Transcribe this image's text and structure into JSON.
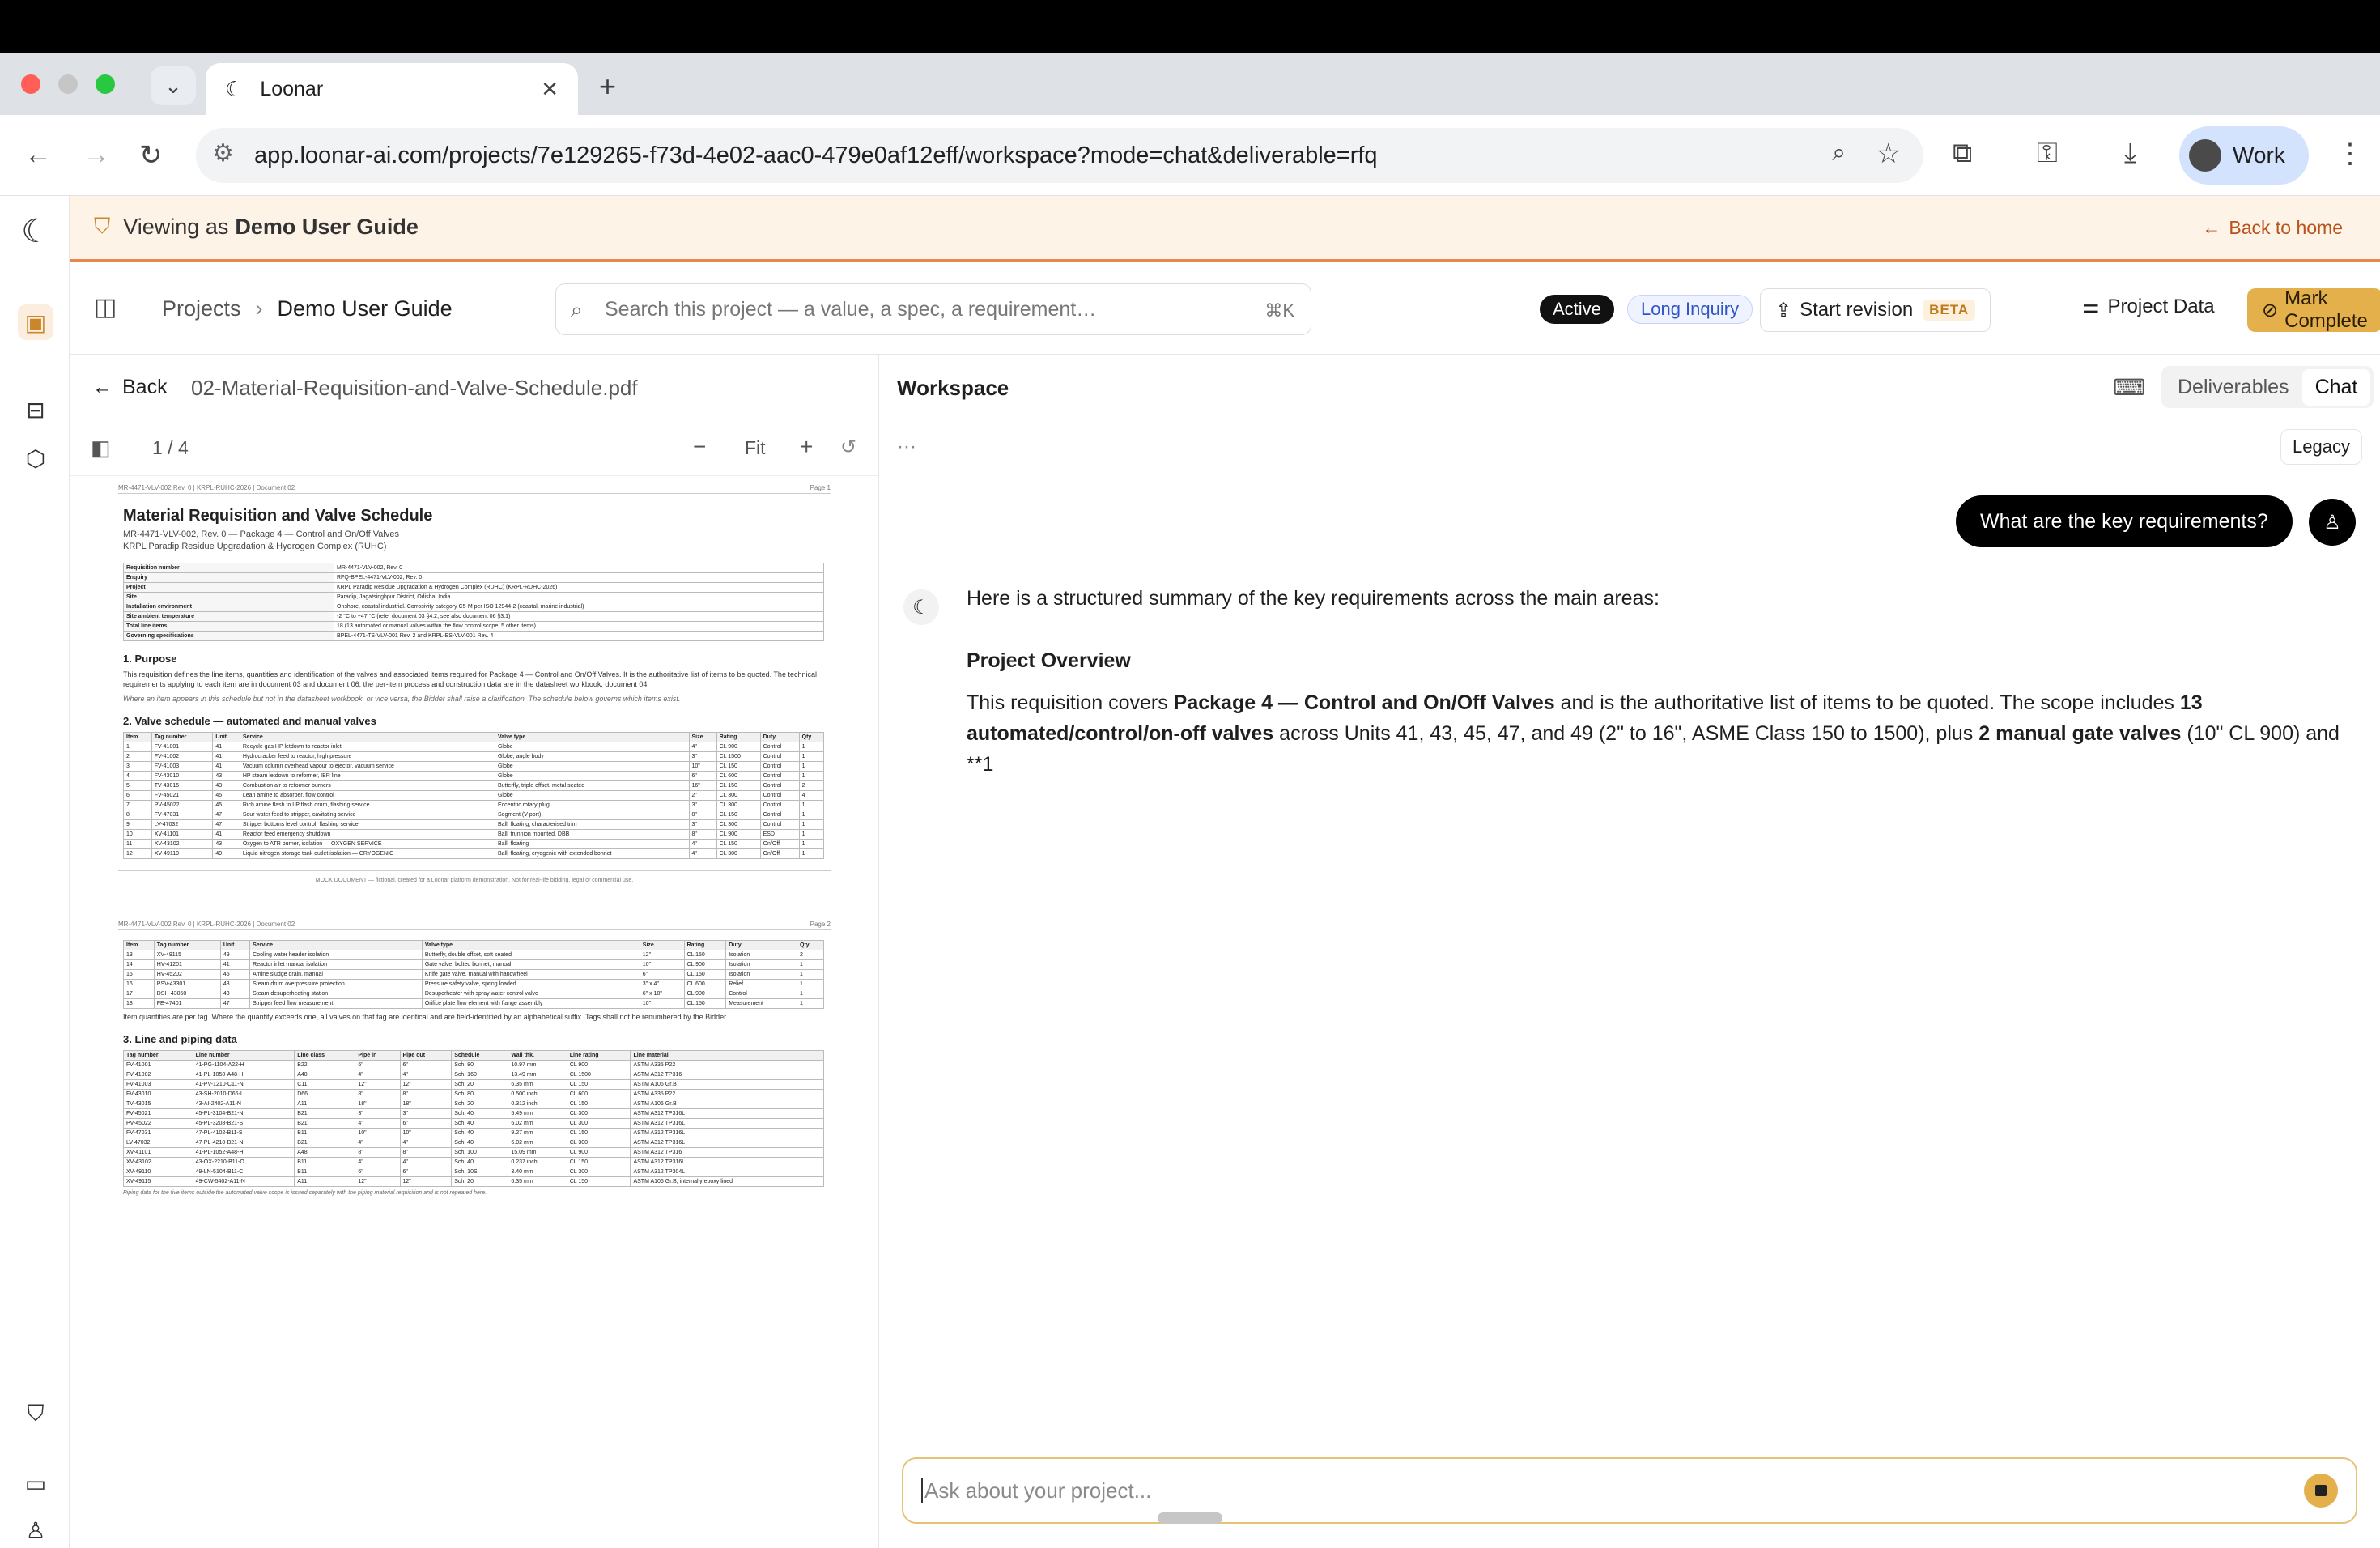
{
  "browser": {
    "tab_title": "Loonar",
    "url": "app.loonar-ai.com/projects/7e129265-f73d-4e02-aac0-479e0af12eff/workspace?mode=chat&deliverable=rfq",
    "profile_label": "Work"
  },
  "banner": {
    "prefix": "Viewing as",
    "user": "Demo User Guide",
    "back_label": "Back to home"
  },
  "header": {
    "breadcrumb_root": "Projects",
    "breadcrumb_current": "Demo User Guide",
    "search_placeholder": "Search this project — a value, a spec, a requirement…",
    "search_shortcut": "⌘K",
    "status_active": "Active",
    "status_inquiry": "Long Inquiry",
    "revision_label": "Start revision",
    "revision_badge": "BETA",
    "project_data_label": "Project Data",
    "complete_label": "Mark Complete"
  },
  "pdf": {
    "back_label": "Back",
    "filename": "02-Material-Requisition-and-Valve-Schedule.pdf",
    "page_indicator": "1 / 4",
    "fit_label": "Fit",
    "page1": {
      "header_left": "MR-4471-VLV-002 Rev. 0 | KRPL-RUHC-2026 | Document 02",
      "header_right": "Page 1",
      "title": "Material Requisition and Valve Schedule",
      "subtitle1": "MR-4471-VLV-002, Rev. 0 — Package 4 — Control and On/Off Valves",
      "subtitle2": "KRPL Paradip Residue Upgradation & Hydrogen Complex (RUHC)",
      "kv": [
        [
          "Requisition number",
          "MR-4471-VLV-002, Rev. 0"
        ],
        [
          "Enquiry",
          "RFQ-BPEL-4471-VLV-002, Rev. 0"
        ],
        [
          "Project",
          "KRPL Paradip Residue Upgradation & Hydrogen Complex (RUHC) (KRPL-RUHC-2026)"
        ],
        [
          "Site",
          "Paradip, Jagatsinghpur District, Odisha, India"
        ],
        [
          "Installation environment",
          "Onshore, coastal industrial. Corrosivity category C5-M per ISO 12944-2 (coastal, marine industrial)"
        ],
        [
          "Site ambient temperature",
          "-2 °C to +47 °C (refer document 03 §4.2; see also document 06 §3.1)"
        ],
        [
          "Total line items",
          "18 (13 automated or manual valves within the flow control scope, 5 other items)"
        ],
        [
          "Governing specifications",
          "BPEL-4471-TS-VLV-001 Rev. 2 and KRPL-ES-VLV-001 Rev. 4"
        ]
      ],
      "purpose_heading": "1. Purpose",
      "purpose_text": "This requisition defines the line items, quantities and identification of the valves and associated items required for Package 4 — Control and On/Off Valves. It is the authoritative list of items to be quoted. The technical requirements applying to each item are in document 03 and document 06; the per-item process and construction data are in the datasheet workbook, document 04.",
      "purpose_note": "Where an item appears in this schedule but not in the datasheet workbook, or vice versa, the Bidder shall raise a clarification. The schedule below governs which items exist.",
      "schedule_heading": "2. Valve schedule — automated and manual valves",
      "schedule_cols": [
        "Item",
        "Tag number",
        "Unit",
        "Service",
        "Valve type",
        "Size",
        "Rating",
        "Duty",
        "Qty"
      ],
      "schedule_rows": [
        [
          "1",
          "FV-41001",
          "41",
          "Recycle gas HP letdown to reactor inlet",
          "Globe",
          "4\"",
          "CL 900",
          "Control",
          "1"
        ],
        [
          "2",
          "FV-41002",
          "41",
          "Hydrocracker feed to reactor, high pressure",
          "Globe, angle body",
          "3\"",
          "CL 1500",
          "Control",
          "1"
        ],
        [
          "3",
          "FV-41003",
          "41",
          "Vacuum column overhead vapour to ejector, vacuum service",
          "Globe",
          "10\"",
          "CL 150",
          "Control",
          "1"
        ],
        [
          "4",
          "FV-43010",
          "43",
          "HP steam letdown to reformer, IBR line",
          "Globe",
          "6\"",
          "CL 600",
          "Control",
          "1"
        ],
        [
          "5",
          "TV-43015",
          "43",
          "Combustion air to reformer burners",
          "Butterfly, triple offset, metal seated",
          "16\"",
          "CL 150",
          "Control",
          "2"
        ],
        [
          "6",
          "FV-45021",
          "45",
          "Lean amine to absorber, flow control",
          "Globe",
          "2\"",
          "CL 300",
          "Control",
          "4"
        ],
        [
          "7",
          "PV-45022",
          "45",
          "Rich amine flash to LP flash drum, flashing service",
          "Eccentric rotary plug",
          "3\"",
          "CL 300",
          "Control",
          "1"
        ],
        [
          "8",
          "FV-47031",
          "47",
          "Sour water feed to stripper, cavitating service",
          "Segment (V-port)",
          "8\"",
          "CL 150",
          "Control",
          "1"
        ],
        [
          "9",
          "LV-47032",
          "47",
          "Stripper bottoms level control, flashing service",
          "Ball, floating, characterised trim",
          "3\"",
          "CL 300",
          "Control",
          "1"
        ],
        [
          "10",
          "XV-41101",
          "41",
          "Reactor feed emergency shutdown",
          "Ball, trunnion mounted, DBB",
          "8\"",
          "CL 900",
          "ESD",
          "1"
        ],
        [
          "11",
          "XV-43102",
          "43",
          "Oxygen to ATR burner, isolation — OXYGEN SERVICE",
          "Ball, floating",
          "4\"",
          "CL 150",
          "On/Off",
          "1"
        ],
        [
          "12",
          "XV-49110",
          "49",
          "Liquid nitrogen storage tank outlet isolation — CRYOGENIC",
          "Ball, floating, cryogenic with extended bonnet",
          "4\"",
          "CL 300",
          "On/Off",
          "1"
        ]
      ],
      "footer": "MOCK DOCUMENT — fictional, created for a Loonar platform demonstration. Not for real-life bidding, legal or commercial use."
    },
    "page2": {
      "header_left": "MR-4471-VLV-002 Rev. 0 | KRPL-RUHC-2026 | Document 02",
      "header_right": "Page 2",
      "schedule_rows": [
        [
          "13",
          "XV-49115",
          "49",
          "Cooling water header isolation",
          "Butterfly, double offset, soft seated",
          "12\"",
          "CL 150",
          "Isolation",
          "2"
        ],
        [
          "14",
          "HV-41201",
          "41",
          "Reactor inlet manual isolation",
          "Gate valve, bolted bonnet, manual",
          "10\"",
          "CL 900",
          "Isolation",
          "1"
        ],
        [
          "15",
          "HV-45202",
          "45",
          "Amine sludge drain, manual",
          "Knife gate valve, manual with handwheel",
          "6\"",
          "CL 150",
          "Isolation",
          "1"
        ],
        [
          "16",
          "PSV-43301",
          "43",
          "Steam drum overpressure protection",
          "Pressure safety valve, spring loaded",
          "3\" x 4\"",
          "CL 600",
          "Relief",
          "1"
        ],
        [
          "17",
          "DSH-43050",
          "43",
          "Steam desuperheating station",
          "Desuperheater with spray water control valve",
          "6\" x 10\"",
          "CL 900",
          "Control",
          "1"
        ],
        [
          "18",
          "FE-47401",
          "47",
          "Stripper feed flow measurement",
          "Orifice plate flow element with flange assembly",
          "10\"",
          "CL 150",
          "Measurement",
          "1"
        ]
      ],
      "qty_note": "Item quantities are per tag. Where the quantity exceeds one, all valves on that tag are identical and are field-identified by an alphabetical suffix. Tags shall not be renumbered by the Bidder.",
      "line_heading": "3. Line and piping data",
      "line_cols": [
        "Tag number",
        "Line number",
        "Line class",
        "Pipe in",
        "Pipe out",
        "Schedule",
        "Wall thk.",
        "Line rating",
        "Line material"
      ],
      "line_rows": [
        [
          "FV-41001",
          "41-PG-1104-A22-H",
          "B22",
          "6\"",
          "6\"",
          "Sch. 80",
          "10.97 mm",
          "CL 900",
          "ASTM A335 P22"
        ],
        [
          "FV-41002",
          "41-PL-1050-A48-H",
          "A48",
          "4\"",
          "4\"",
          "Sch. 160",
          "13.49 mm",
          "CL 1500",
          "ASTM A312 TP316"
        ],
        [
          "FV-41003",
          "41-PV-1210-C11-N",
          "C11",
          "12\"",
          "12\"",
          "Sch. 20",
          "6.35 mm",
          "CL 150",
          "ASTM A106 Gr.B"
        ],
        [
          "FV-43010",
          "43-SH-2010-D66-I",
          "D66",
          "8\"",
          "8\"",
          "Sch. 80",
          "0.500 inch",
          "CL 600",
          "ASTM A335 P22"
        ],
        [
          "TV-43015",
          "43-AI-2402-A11-N",
          "A11",
          "18\"",
          "18\"",
          "Sch. 20",
          "0.312 inch",
          "CL 150",
          "ASTM A106 Gr.B"
        ],
        [
          "FV-45021",
          "45-PL-3104-B21-N",
          "B21",
          "3\"",
          "3\"",
          "Sch. 40",
          "5.49 mm",
          "CL 300",
          "ASTM A312 TP316L"
        ],
        [
          "PV-45022",
          "45-PL-3208-B21-S",
          "B21",
          "4\"",
          "6\"",
          "Sch. 40",
          "6.02 mm",
          "CL 300",
          "ASTM A312 TP316L"
        ],
        [
          "FV-47031",
          "47-PL-4102-B11-S",
          "B11",
          "10\"",
          "10\"",
          "Sch. 40",
          "9.27 mm",
          "CL 150",
          "ASTM A312 TP316L"
        ],
        [
          "LV-47032",
          "47-PL-4210-B21-N",
          "B21",
          "4\"",
          "4\"",
          "Sch. 40",
          "6.02 mm",
          "CL 300",
          "ASTM A312 TP316L"
        ],
        [
          "XV-41101",
          "41-PL-1052-A48-H",
          "A48",
          "8\"",
          "8\"",
          "Sch. 100",
          "15.09 mm",
          "CL 900",
          "ASTM A312 TP316"
        ],
        [
          "XV-43102",
          "43-OX-2210-B11-O",
          "B11",
          "4\"",
          "4\"",
          "Sch. 40",
          "0.237 inch",
          "CL 150",
          "ASTM A312 TP316L"
        ],
        [
          "XV-49110",
          "49-LN-5104-B11-C",
          "B11",
          "6\"",
          "6\"",
          "Sch. 10S",
          "3.40 mm",
          "CL 300",
          "ASTM A312 TP304L"
        ],
        [
          "XV-49115",
          "49-CW-5402-A11-N",
          "A11",
          "12\"",
          "12\"",
          "Sch. 20",
          "6.35 mm",
          "CL 150",
          "ASTM A106 Gr.B, internally epoxy lined"
        ]
      ],
      "line_note": "Piping data for the five items outside the automated valve scope is issued separately with the piping material requisition and is not repeated here."
    }
  },
  "workspace": {
    "title": "Workspace",
    "tab_deliverables": "Deliverables",
    "tab_chat": "Chat",
    "legacy_label": "Legacy",
    "user_message": "What are the key requirements?",
    "bot_intro": "Here is a structured summary of the key requirements across the main areas:",
    "section_heading": "Project Overview",
    "para_1": "This requisition covers ",
    "para_b1": "Package 4 — Control and On/Off Valves",
    "para_2": " and is the authoritative list of items to be quoted. The scope includes ",
    "para_b2": "13 automated/control/on-off valves",
    "para_3": " across Units 41, 43, 45, 47, and 49 (2\" to 16\", ASME Class 150 to 1500), plus ",
    "para_b3": "2 manual gate valves",
    "para_4": " (10\" CL 900) and **1",
    "composer_placeholder": "Ask about your project..."
  }
}
